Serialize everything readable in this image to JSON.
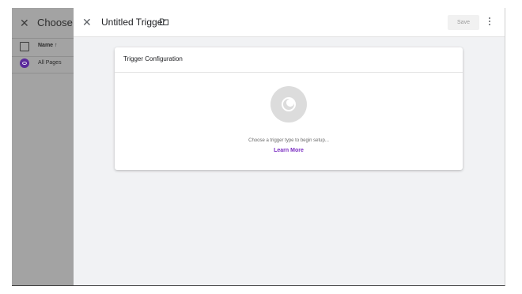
{
  "background_panel": {
    "title": "Choose a t",
    "column_header": "Name ↑",
    "items": [
      {
        "label": "All Pages"
      }
    ]
  },
  "header": {
    "title": "Untitled Trigger",
    "save_label": "Save"
  },
  "card": {
    "title": "Trigger Configuration",
    "hint": "Choose a trigger type to begin setup...",
    "learn_more": "Learn More"
  },
  "colors": {
    "accent": "#7a2dc1",
    "icon_circle": "#dcdcdc",
    "sheet_background": "#f1f2f4"
  }
}
